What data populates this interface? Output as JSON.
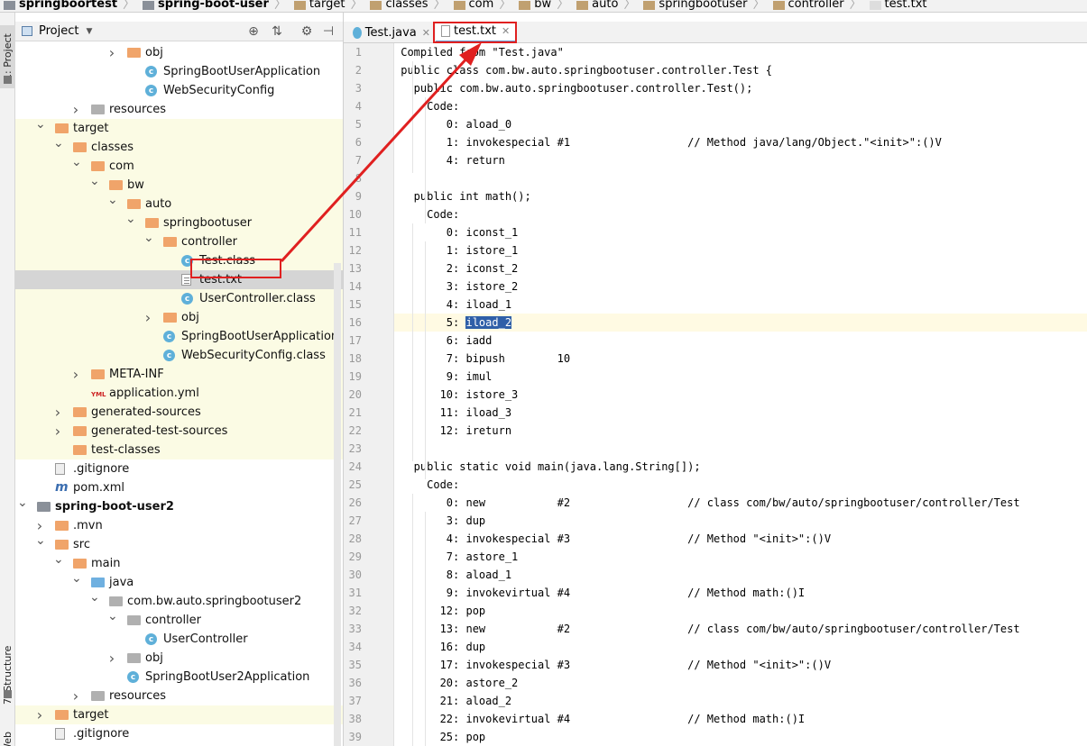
{
  "breadcrumb": [
    "springboortest",
    "spring-boot-user",
    "target",
    "classes",
    "com",
    "bw",
    "auto",
    "springbootuser",
    "controller",
    "test.txt"
  ],
  "toolstrip": {
    "project_tab": "1: Project",
    "structure_tab": "7: Structure",
    "web_tab": "Web"
  },
  "project_panel": {
    "title": "Project"
  },
  "tree": [
    {
      "label": "obj",
      "icon": "folder-icon",
      "depth": 6
    },
    {
      "label": "SpringBootUserApplication",
      "icon": "class-icon",
      "depth": 7
    },
    {
      "label": "WebSecurityConfig",
      "icon": "class-icon",
      "depth": 7
    },
    {
      "label": "resources",
      "icon": "resources-folder-icon",
      "depth": 4
    },
    {
      "label": "target",
      "icon": "folder-icon",
      "depth": 2
    },
    {
      "label": "classes",
      "icon": "folder-icon",
      "depth": 3
    },
    {
      "label": "com",
      "icon": "folder-icon",
      "depth": 4
    },
    {
      "label": "bw",
      "icon": "folder-icon",
      "depth": 5
    },
    {
      "label": "auto",
      "icon": "folder-icon",
      "depth": 6
    },
    {
      "label": "springbootuser",
      "icon": "folder-icon",
      "depth": 7
    },
    {
      "label": "controller",
      "icon": "folder-icon",
      "depth": 8
    },
    {
      "label": "Test.class",
      "icon": "class-icon",
      "depth": 9
    },
    {
      "label": "test.txt",
      "icon": "text-file-icon",
      "depth": 9
    },
    {
      "label": "UserController.class",
      "icon": "class-icon",
      "depth": 9
    },
    {
      "label": "obj",
      "icon": "folder-icon",
      "depth": 8
    },
    {
      "label": "SpringBootUserApplication.c",
      "icon": "class-icon",
      "depth": 8
    },
    {
      "label": "WebSecurityConfig.class",
      "icon": "class-icon",
      "depth": 8
    },
    {
      "label": "META-INF",
      "icon": "folder-icon",
      "depth": 4
    },
    {
      "label": "application.yml",
      "icon": "yml-file-icon",
      "depth": 4
    },
    {
      "label": "generated-sources",
      "icon": "folder-icon",
      "depth": 3
    },
    {
      "label": "generated-test-sources",
      "icon": "folder-icon",
      "depth": 3
    },
    {
      "label": "test-classes",
      "icon": "folder-icon",
      "depth": 3
    },
    {
      "label": ".gitignore",
      "icon": "gitignore-icon",
      "depth": 2
    },
    {
      "label": "pom.xml",
      "icon": "maven-icon",
      "depth": 2
    },
    {
      "label": "spring-boot-user2",
      "icon": "module-icon",
      "depth": 1
    },
    {
      "label": ".mvn",
      "icon": "folder-icon",
      "depth": 2
    },
    {
      "label": "src",
      "icon": "folder-icon",
      "depth": 2
    },
    {
      "label": "main",
      "icon": "folder-icon",
      "depth": 3
    },
    {
      "label": "java",
      "icon": "source-folder-icon",
      "depth": 4
    },
    {
      "label": "com.bw.auto.springbootuser2",
      "icon": "package-icon",
      "depth": 5
    },
    {
      "label": "controller",
      "icon": "package-icon",
      "depth": 6
    },
    {
      "label": "UserController",
      "icon": "class-icon",
      "depth": 7
    },
    {
      "label": "obj",
      "icon": "package-icon",
      "depth": 6
    },
    {
      "label": "SpringBootUser2Application",
      "icon": "class-icon",
      "depth": 6
    },
    {
      "label": "resources",
      "icon": "resources-folder-icon",
      "depth": 4
    },
    {
      "label": "target",
      "icon": "folder-icon",
      "depth": 2
    },
    {
      "label": ".gitignore",
      "icon": "gitignore-icon",
      "depth": 2
    },
    {
      "label": "pom.xml",
      "icon": "maven-icon",
      "depth": 2
    }
  ],
  "editor_tabs": [
    {
      "label": "Test.java",
      "active": false
    },
    {
      "label": "test.txt",
      "active": true
    }
  ],
  "code_lines": [
    "Compiled from \"Test.java\"",
    "public class com.bw.auto.springbootuser.controller.Test {",
    "  public com.bw.auto.springbootuser.controller.Test();",
    "    Code:",
    "       0: aload_0",
    "       1: invokespecial #1                  // Method java/lang/Object.\"<init>\":()V",
    "       4: return",
    "",
    "  public int math();",
    "    Code:",
    "       0: iconst_1",
    "       1: istore_1",
    "       2: iconst_2",
    "       3: istore_2",
    "       4: iload_1",
    "       5: iload_2",
    "       6: iadd",
    "       7: bipush        10",
    "       9: imul",
    "      10: istore_3",
    "      11: iload_3",
    "      12: ireturn",
    "",
    "  public static void main(java.lang.String[]);",
    "    Code:",
    "       0: new           #2                  // class com/bw/auto/springbootuser/controller/Test",
    "       3: dup",
    "       4: invokespecial #3                  // Method \"<init>\":()V",
    "       7: astore_1",
    "       8: aload_1",
    "       9: invokevirtual #4                  // Method math:()I",
    "      12: pop",
    "      13: new           #2                  // class com/bw/auto/springbootuser/controller/Test",
    "      16: dup",
    "      17: invokespecial #3                  // Method \"<init>\":()V",
    "      20: astore_2",
    "      21: aload_2",
    "      22: invokevirtual #4                  // Method math:()I",
    "      25: pop"
  ],
  "highlight": {
    "line": 16,
    "text": "iload_2"
  },
  "colors": {
    "annotation_red": "#e02020",
    "accent_blue": "#6b9bd2",
    "target_yellow": "#fbfbe4"
  }
}
